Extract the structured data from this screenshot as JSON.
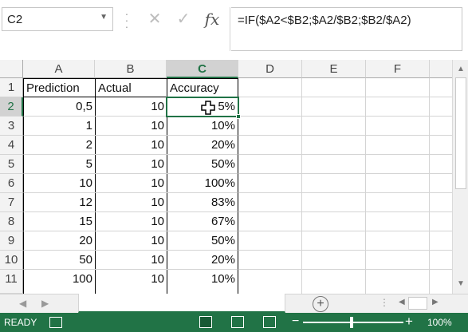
{
  "formula_bar": {
    "name_box": "C2",
    "cancel_glyph": "✕",
    "enter_glyph": "✓",
    "fx_glyph": "fx",
    "formula": "=IF($A2<$B2;$A2/$B2;$B2/$A2)"
  },
  "columns": [
    "A",
    "B",
    "C",
    "D",
    "E",
    "F"
  ],
  "selected_column": "C",
  "rows": [
    "1",
    "2",
    "3",
    "4",
    "5",
    "6",
    "7",
    "8",
    "9",
    "10",
    "11"
  ],
  "selected_row": "2",
  "table": {
    "headers": [
      "Prediction",
      "Actual",
      "Accuracy"
    ],
    "data": [
      [
        "0,5",
        "10",
        "5%"
      ],
      [
        "1",
        "10",
        "10%"
      ],
      [
        "2",
        "10",
        "20%"
      ],
      [
        "5",
        "10",
        "50%"
      ],
      [
        "10",
        "10",
        "100%"
      ],
      [
        "12",
        "10",
        "83%"
      ],
      [
        "15",
        "10",
        "67%"
      ],
      [
        "20",
        "10",
        "50%"
      ],
      [
        "50",
        "10",
        "20%"
      ],
      [
        "100",
        "10",
        "10%"
      ]
    ]
  },
  "status_bar": {
    "mode": "READY",
    "zoom_minus": "−",
    "zoom_plus": "+",
    "zoom": "100%"
  },
  "sheet_tabs": {
    "add_glyph": "+",
    "prev_glyph": "◀",
    "next_glyph": "▶",
    "ellipsis": "⋮"
  },
  "colors": {
    "accent": "#217346",
    "header_bg": "#f3f3f3",
    "selected_header_bg": "#d2d2d2",
    "gridline": "#d4d4d4"
  }
}
